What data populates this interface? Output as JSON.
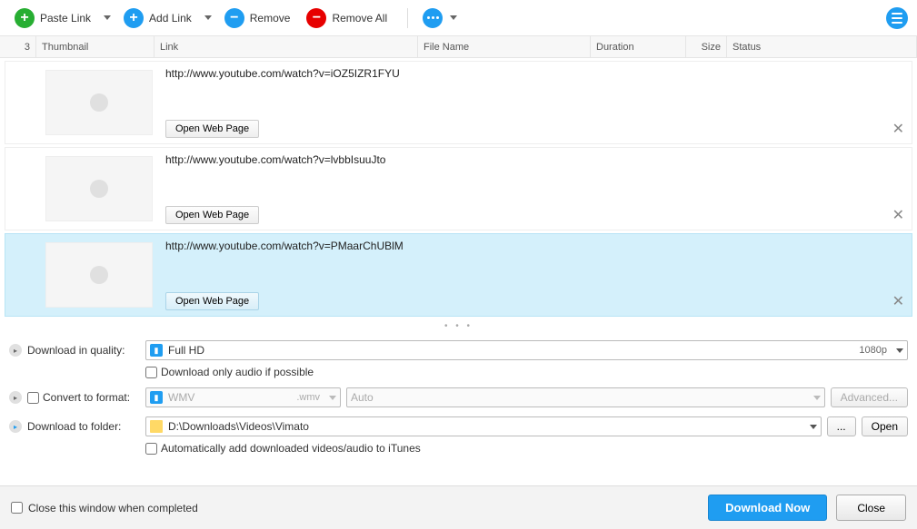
{
  "toolbar": {
    "paste_link": "Paste Link",
    "add_link": "Add Link",
    "remove": "Remove",
    "remove_all": "Remove All"
  },
  "headers": {
    "count": "3",
    "thumbnail": "Thumbnail",
    "link": "Link",
    "file_name": "File Name",
    "duration": "Duration",
    "size": "Size",
    "status": "Status"
  },
  "rows": [
    {
      "url": "http://www.youtube.com/watch?v=iOZ5IZR1FYU",
      "open": "Open Web Page"
    },
    {
      "url": "http://www.youtube.com/watch?v=lvbbIsuuJto",
      "open": "Open Web Page"
    },
    {
      "url": "http://www.youtube.com/watch?v=PMaarChUBlM",
      "open": "Open Web Page"
    }
  ],
  "settings": {
    "quality_label": "Download in quality:",
    "quality_value": "Full HD",
    "quality_res": "1080p",
    "audio_only": "Download only audio if possible",
    "convert_label": "Convert to format:",
    "convert_value": "WMV",
    "convert_ext": ".wmv",
    "convert_auto": "Auto",
    "advanced": "Advanced...",
    "folder_label": "Download to folder:",
    "folder_path": "D:\\Downloads\\Videos\\Vimato",
    "browse": "...",
    "open": "Open",
    "itunes": "Automatically add downloaded videos/audio to iTunes"
  },
  "footer": {
    "close_when_done": "Close this window when completed",
    "download_now": "Download Now",
    "close": "Close"
  }
}
